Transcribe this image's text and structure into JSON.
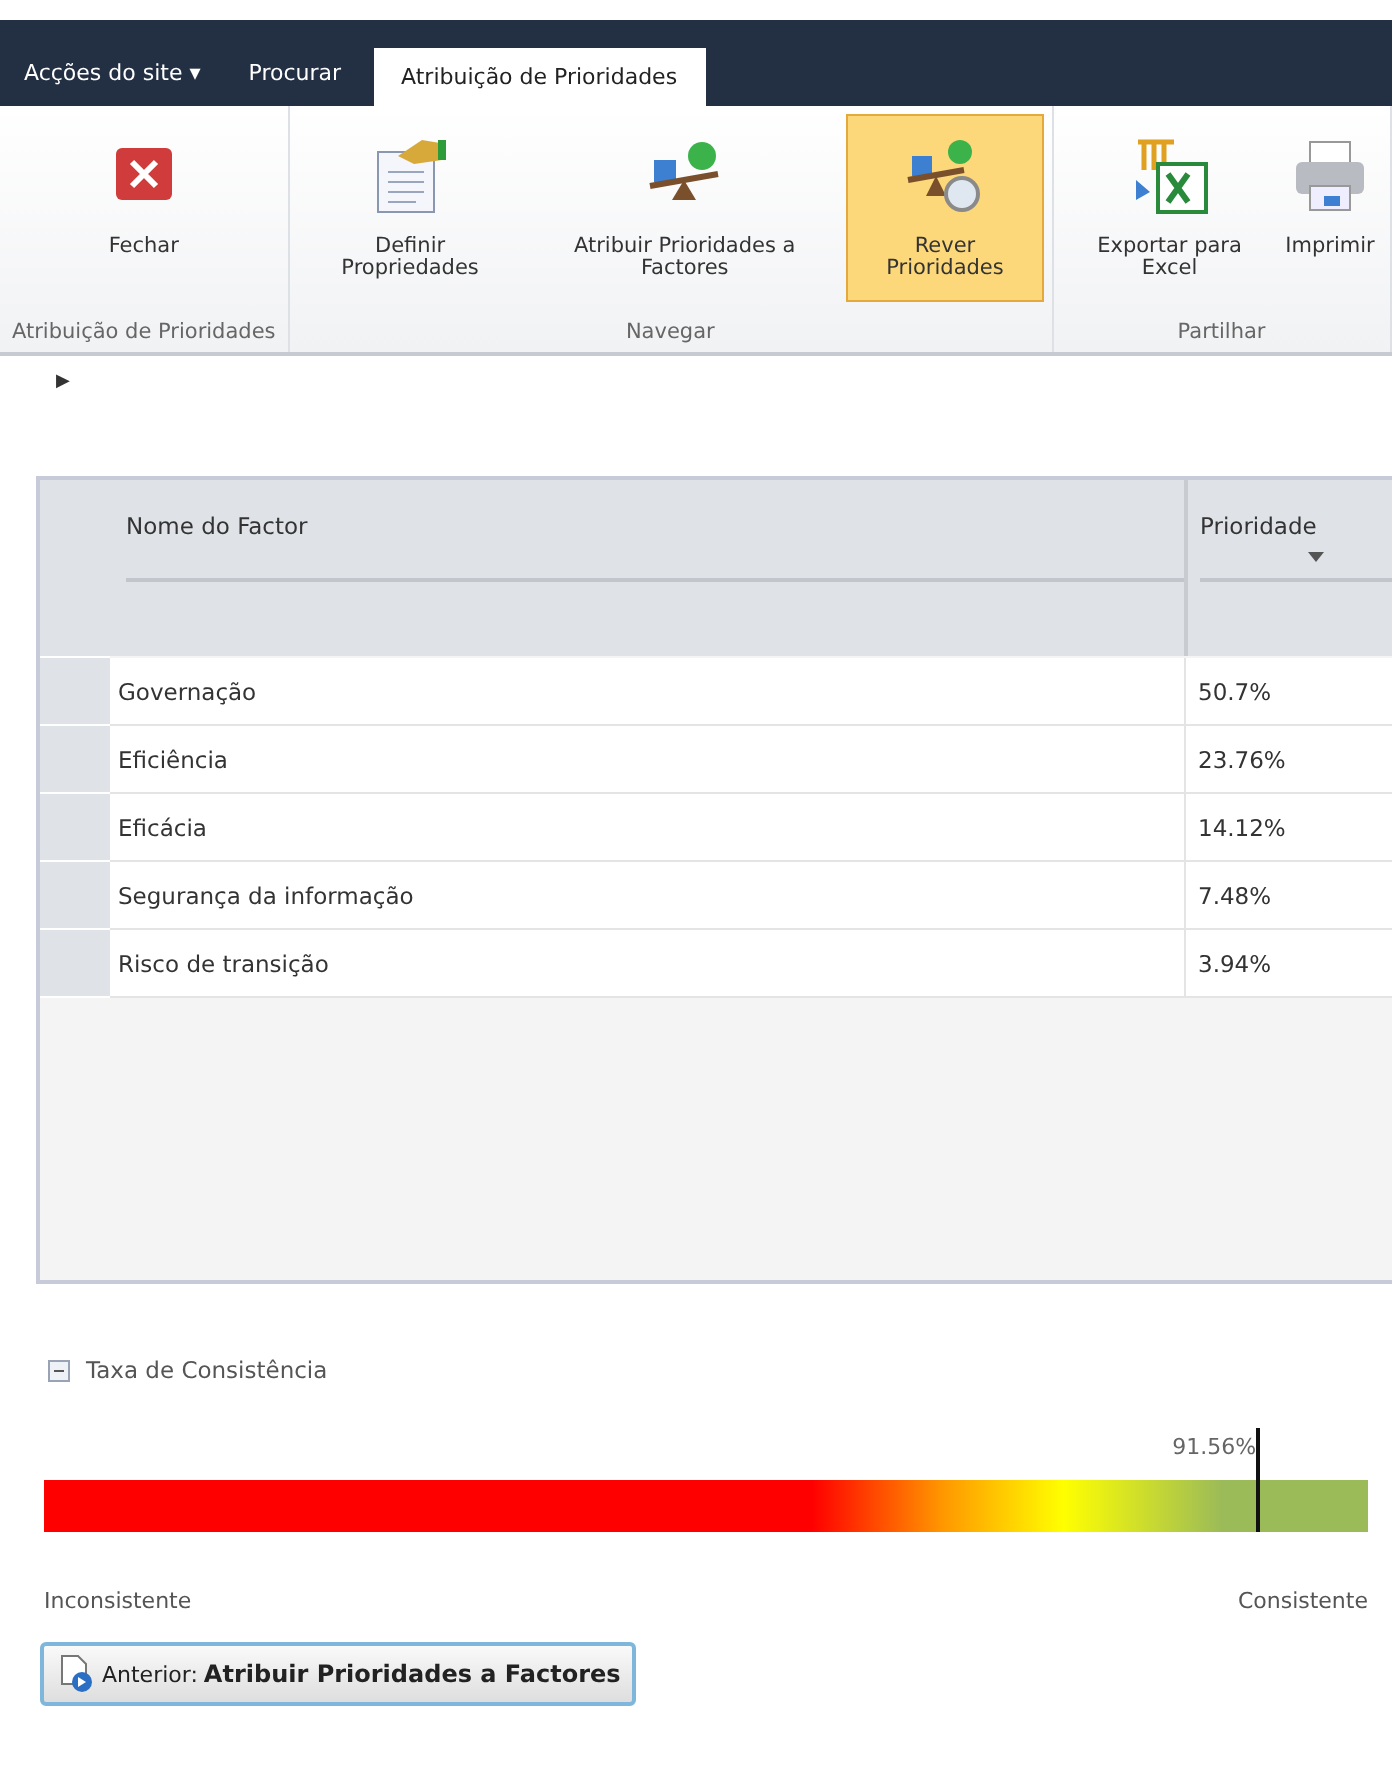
{
  "nav": {
    "menu": {
      "label": "Acções do site",
      "caret": "▾"
    },
    "tabs": [
      {
        "label": "Procurar",
        "selected": false
      },
      {
        "label": "Atribuição de Prioridades",
        "selected": true
      }
    ]
  },
  "ribbon": {
    "groups": [
      {
        "label": "Atribuição de Prioridades",
        "buttons": [
          {
            "kind": "close",
            "label": "Fechar",
            "selected": false
          }
        ]
      },
      {
        "label": "Navegar",
        "buttons": [
          {
            "kind": "properties",
            "label": "Definir Propriedades",
            "selected": false
          },
          {
            "kind": "assign",
            "label": "Atribuir Prioridades a Factores",
            "selected": false
          },
          {
            "kind": "review",
            "label": "Rever Prioridades",
            "selected": true
          }
        ]
      },
      {
        "label": "Partilhar",
        "buttons": [
          {
            "kind": "excel",
            "label": "Exportar para Excel",
            "selected": false
          },
          {
            "kind": "print",
            "label": "Imprimir",
            "selected": false
          }
        ]
      }
    ]
  },
  "expand_arrow": "▶",
  "table": {
    "columns": [
      {
        "label": "Nome do Factor",
        "sortable": false
      },
      {
        "label": "Prioridade",
        "sortable": true
      }
    ],
    "rows": [
      {
        "name": "Governação",
        "priority": "50.7%"
      },
      {
        "name": "Eficiência",
        "priority": "23.76%"
      },
      {
        "name": "Eficácia",
        "priority": "14.12%"
      },
      {
        "name": "Segurança da informação",
        "priority": "7.48%"
      },
      {
        "name": "Risco de transição",
        "priority": "3.94%"
      }
    ]
  },
  "consistency": {
    "title": "Taxa de Consistência",
    "expanded": true,
    "reading": "91.56%",
    "level": 0.9156,
    "min_label": "Inconsistente",
    "max_label": "Consistente"
  },
  "back_button": {
    "prefix": "Anterior:",
    "label": "Atribuir Prioridades a Factores"
  }
}
